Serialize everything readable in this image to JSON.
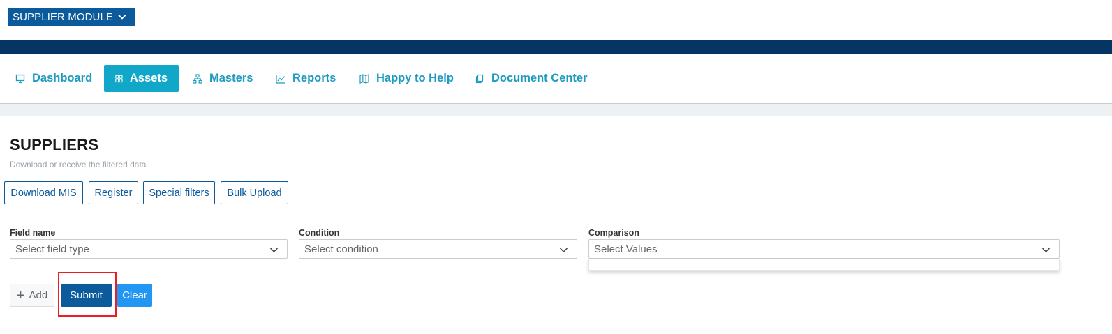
{
  "module_selector": {
    "label": "SUPPLIER MODULE",
    "icon": "chevron-down-icon"
  },
  "nav": {
    "items": [
      {
        "label": "Dashboard",
        "icon": "monitor-icon",
        "active": false
      },
      {
        "label": "Assets",
        "icon": "grid-icon",
        "active": true
      },
      {
        "label": "Masters",
        "icon": "hierarchy-icon",
        "active": false
      },
      {
        "label": "Reports",
        "icon": "line-chart-icon",
        "active": false
      },
      {
        "label": "Happy to Help",
        "icon": "map-icon",
        "active": false
      },
      {
        "label": "Document Center",
        "icon": "documents-icon",
        "active": false
      }
    ]
  },
  "page": {
    "title": "SUPPLIERS",
    "subtitle": "Download or receive the filtered data."
  },
  "actions": [
    {
      "label": "Download MIS"
    },
    {
      "label": "Register"
    },
    {
      "label": "Special filters"
    },
    {
      "label": "Bulk Upload"
    }
  ],
  "filters": {
    "field_name": {
      "label": "Field name",
      "placeholder": "Select field type"
    },
    "condition": {
      "label": "Condition",
      "placeholder": "Select condition"
    },
    "comparison": {
      "label": "Comparison",
      "placeholder": "Select Values"
    }
  },
  "buttons": {
    "add": "Add",
    "submit": "Submit",
    "clear": "Clear"
  },
  "colors": {
    "primary": "#0a5a9c",
    "topbar": "#053562",
    "nav_text": "#1c9bc0",
    "nav_active_bg": "#11a7c9",
    "clear_bg": "#2196f3",
    "highlight": "#ec1c24"
  }
}
